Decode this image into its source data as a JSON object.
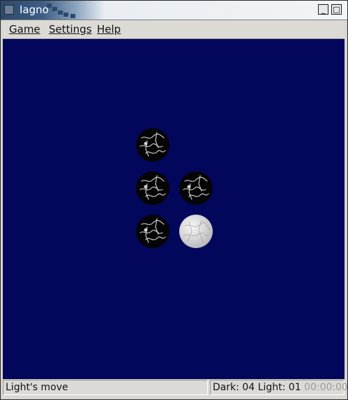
{
  "window": {
    "title": "Iagno"
  },
  "menu": {
    "game": "Game",
    "settings": "Settings",
    "help": "Help"
  },
  "status": {
    "move": "Light's move",
    "dark_label": "Dark:",
    "dark_count": "04",
    "light_label": "Light:",
    "light_count": "01",
    "timer": "00:00:00"
  },
  "board": {
    "background": "#02075c",
    "pieces": [
      {
        "row": 0,
        "col": 0,
        "color": "dark"
      },
      {
        "row": 1,
        "col": 0,
        "color": "dark"
      },
      {
        "row": 1,
        "col": 1,
        "color": "dark"
      },
      {
        "row": 2,
        "col": 0,
        "color": "dark"
      },
      {
        "row": 2,
        "col": 1,
        "color": "light"
      }
    ]
  }
}
